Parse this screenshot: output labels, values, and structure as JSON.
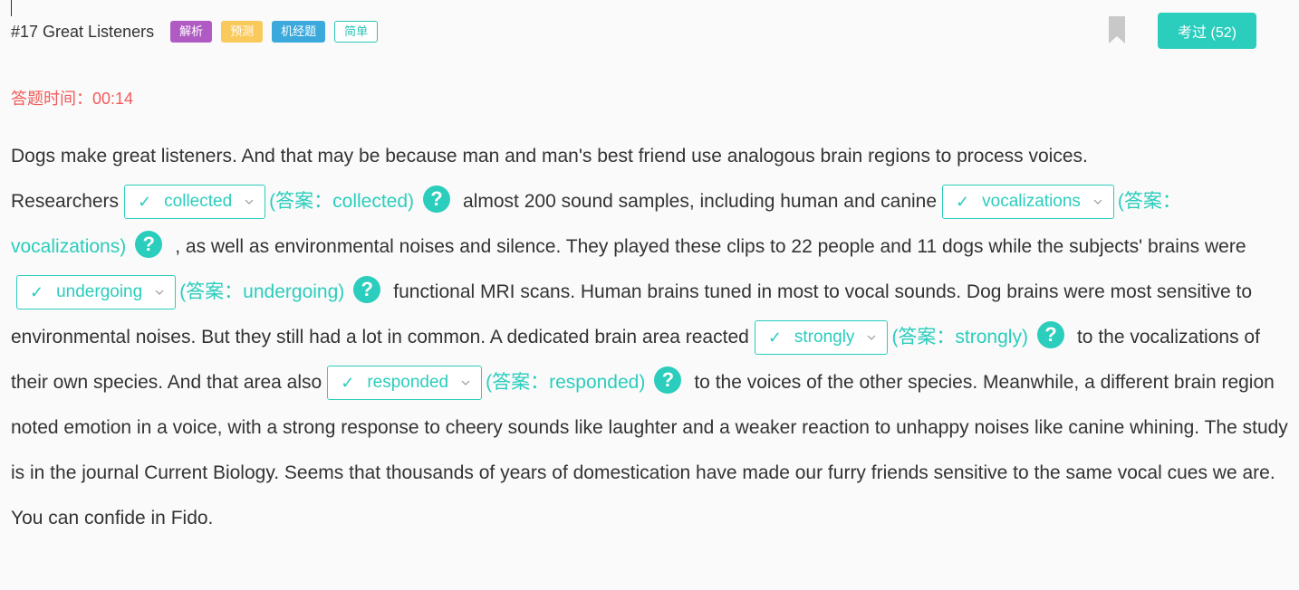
{
  "header": {
    "title": "#17 Great Listeners",
    "tags": [
      "解析",
      "预测",
      "机经题",
      "简单"
    ],
    "exam_button": "考过 (52)"
  },
  "timer": "答题时间：00:14",
  "article": {
    "p1": "Dogs make great listeners. And that may be because man and man's best friend use analogous brain regions to process voices.",
    "p2": "Researchers",
    "blank1": {
      "value": "collected",
      "answer": "(答案：collected)"
    },
    "p3": "almost 200 sound samples, including human and canine",
    "blank2": {
      "value": "vocalizations",
      "answer": "(答案：vocalizations)"
    },
    "p4": ", as well as environmental noises and silence. They played these clips to 22 people and 11 dogs while the subjects' brains were",
    "blank3": {
      "value": "undergoing",
      "answer": "(答案：undergoing)"
    },
    "p5": "functional MRI scans. Human brains tuned in most to vocal sounds. Dog brains were most sensitive to environmental noises. But they still had a lot in common. A dedicated brain area reacted",
    "blank4": {
      "value": "strongly",
      "answer": "(答案：strongly)"
    },
    "p6": "to the vocalizations of their own species. And that area also",
    "blank5": {
      "value": "responded",
      "answer": "(答案：responded)"
    },
    "p7": "to the voices of the other species. Meanwhile, a different brain region noted emotion in a voice, with a strong response to cheery sounds like laughter and a weaker reaction to unhappy noises like canine whining. The study is in the journal Current Biology. Seems that thousands of years of domestication have made our furry friends sensitive to the same vocal cues we are. You can confide in Fido.",
    "check_glyph": "✓",
    "help_glyph": "?"
  },
  "colors": {
    "accent": "#2bcdbd",
    "timer": "#f25b5b",
    "tag_purple": "#b05bc3",
    "tag_yellow": "#f9c95b",
    "tag_blue": "#3ba9db"
  }
}
